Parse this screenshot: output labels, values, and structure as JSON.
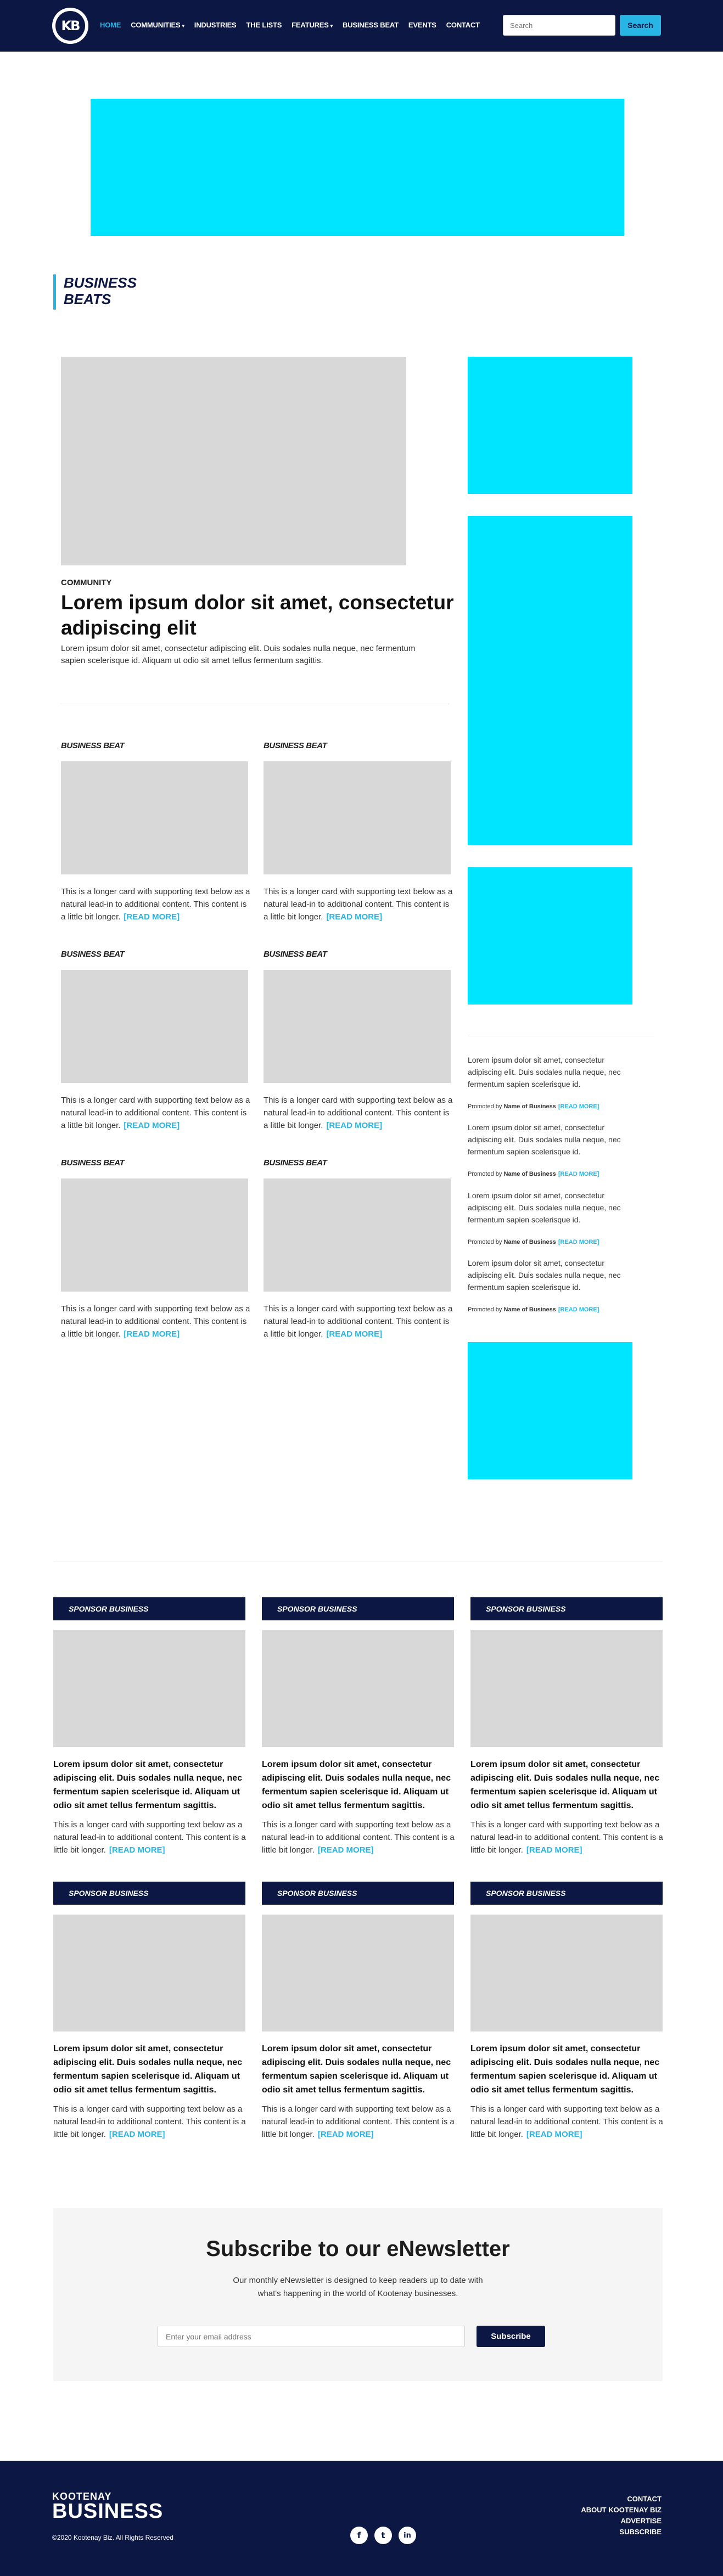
{
  "header": {
    "logo_text": "KB",
    "nav": [
      {
        "label": "HOME",
        "active": true,
        "dropdown": false
      },
      {
        "label": "COMMUNITIES",
        "active": false,
        "dropdown": true
      },
      {
        "label": "INDUSTRIES",
        "active": false,
        "dropdown": false
      },
      {
        "label": "THE LISTS",
        "active": false,
        "dropdown": false
      },
      {
        "label": "FEATURES",
        "active": false,
        "dropdown": true
      },
      {
        "label": "BUSINESS BEAT",
        "active": false,
        "dropdown": false
      },
      {
        "label": "EVENTS",
        "active": false,
        "dropdown": false
      },
      {
        "label": "CONTACT",
        "active": false,
        "dropdown": false
      }
    ],
    "search_placeholder": "Search",
    "search_button": "Search"
  },
  "section_title": "BUSINESS BEATS",
  "featured": {
    "category": "COMMUNITY",
    "title": "Lorem ipsum dolor sit amet, consectetur adipiscing elit",
    "excerpt": "Lorem ipsum dolor sit amet, consectetur adipiscing elit. Duis sodales nulla neque, nec fermentum sapien scelerisque id. Aliquam ut odio sit amet tellus fermentum sagittis."
  },
  "cards": [
    {
      "label": "BUSINESS BEAT",
      "text": "This is a longer card with supporting text below as a natural lead-in to additional content. This content is a little bit longer.",
      "more": "[READ MORE]"
    },
    {
      "label": "BUSINESS BEAT",
      "text": "This is a longer card with supporting text below as a natural lead-in to additional content. This content is a little bit longer.",
      "more": "[READ MORE]"
    },
    {
      "label": "BUSINESS BEAT",
      "text": "This is a longer card with supporting text below as a natural lead-in to additional content. This content is a little bit longer.",
      "more": "[READ MORE]"
    },
    {
      "label": "BUSINESS BEAT",
      "text": "This is a longer card with supporting text below as a natural lead-in to additional content. This content is a little bit longer.",
      "more": "[READ MORE]"
    },
    {
      "label": "BUSINESS BEAT",
      "text": "This is a longer card with supporting text below as a natural lead-in to additional content. This content is a little bit longer.",
      "more": "[READ MORE]"
    },
    {
      "label": "BUSINESS BEAT",
      "text": "This is a longer card with supporting text below as a natural lead-in to additional content. This content is a little bit longer.",
      "more": "[READ MORE]"
    }
  ],
  "promoted": [
    {
      "text": "Lorem ipsum dolor sit amet, consectetur adipiscing elit. Duis sodales nulla neque, nec fermentum sapien scelerisque id.",
      "by_prefix": "Promoted by",
      "by_name": "Name of Business",
      "more": "[READ MORE]"
    },
    {
      "text": "Lorem ipsum dolor sit amet, consectetur adipiscing elit. Duis sodales nulla neque, nec fermentum sapien scelerisque id.",
      "by_prefix": "Promoted by",
      "by_name": "Name of Business",
      "more": "[READ MORE]"
    },
    {
      "text": "Lorem ipsum dolor sit amet, consectetur adipiscing elit. Duis sodales nulla neque, nec fermentum sapien scelerisque id.",
      "by_prefix": "Promoted by",
      "by_name": "Name of Business",
      "more": "[READ MORE]"
    },
    {
      "text": "Lorem ipsum dolor sit amet, consectetur adipiscing elit. Duis sodales nulla neque, nec fermentum sapien scelerisque id.",
      "by_prefix": "Promoted by",
      "by_name": "Name of Business",
      "more": "[READ MORE]"
    }
  ],
  "sponsors": [
    {
      "label": "SPONSOR BUSINESS",
      "title": "Lorem ipsum dolor sit amet, consectetur adipiscing elit. Duis sodales nulla neque, nec fermentum sapien scelerisque id. Aliquam ut odio sit amet tellus fermentum sagittis.",
      "text": "This is a longer card with supporting text below as a natural lead-in to additional content. This content is a little bit longer.",
      "more": "[READ MORE]"
    },
    {
      "label": "SPONSOR BUSINESS",
      "title": "Lorem ipsum dolor sit amet, consectetur adipiscing elit. Duis sodales nulla neque, nec fermentum sapien scelerisque id. Aliquam ut odio sit amet tellus fermentum sagittis.",
      "text": "This is a longer card with supporting text below as a natural lead-in to additional content. This content is a little bit longer.",
      "more": "[READ MORE]"
    },
    {
      "label": "SPONSOR BUSINESS",
      "title": "Lorem ipsum dolor sit amet, consectetur adipiscing elit. Duis sodales nulla neque, nec fermentum sapien scelerisque id. Aliquam ut odio sit amet tellus fermentum sagittis.",
      "text": "This is a longer card with supporting text below as a natural lead-in to additional content. This content is a little bit longer.",
      "more": "[READ MORE]"
    },
    {
      "label": "SPONSOR BUSINESS",
      "title": "Lorem ipsum dolor sit amet, consectetur adipiscing elit. Duis sodales nulla neque, nec fermentum sapien scelerisque id. Aliquam ut odio sit amet tellus fermentum sagittis.",
      "text": "This is a longer card with supporting text below as a natural lead-in to additional content. This content is a little bit longer.",
      "more": "[READ MORE]"
    },
    {
      "label": "SPONSOR BUSINESS",
      "title": "Lorem ipsum dolor sit amet, consectetur adipiscing elit. Duis sodales nulla neque, nec fermentum sapien scelerisque id. Aliquam ut odio sit amet tellus fermentum sagittis.",
      "text": "This is a longer card with supporting text below as a natural lead-in to additional content. This content is a little bit longer.",
      "more": "[READ MORE]"
    },
    {
      "label": "SPONSOR BUSINESS",
      "title": "Lorem ipsum dolor sit amet, consectetur adipiscing elit. Duis sodales nulla neque, nec fermentum sapien scelerisque id. Aliquam ut odio sit amet tellus fermentum sagittis.",
      "text": "This is a longer card with supporting text below as a natural lead-in to additional content. This content is a little bit longer.",
      "more": "[READ MORE]"
    }
  ],
  "newsletter": {
    "title": "Subscribe to our eNewsletter",
    "description": "Our monthly eNewsletter is designed to keep readers up to date with what's happening in the world of Kootenay businesses.",
    "placeholder": "Enter your email address",
    "button": "Subscribe"
  },
  "footer": {
    "brand_top": "KOOTENAY",
    "brand_bottom": "BUSINESS",
    "copyright": "©2020 Kootenay Biz. All Rights Reserved",
    "social": [
      {
        "icon": "facebook-icon",
        "glyph": "f"
      },
      {
        "icon": "twitter-icon",
        "glyph": "t"
      },
      {
        "icon": "linkedin-icon",
        "glyph": "in"
      }
    ],
    "links": [
      "CONTACT",
      "ABOUT KOOTENAY BIZ",
      "ADVERTISE",
      "SUBSCRIBE"
    ]
  },
  "colors": {
    "navy": "#0c1743",
    "accent": "#27b5e6",
    "ad_placeholder": "#00e5ff",
    "image_placeholder": "#d8d8d8"
  }
}
